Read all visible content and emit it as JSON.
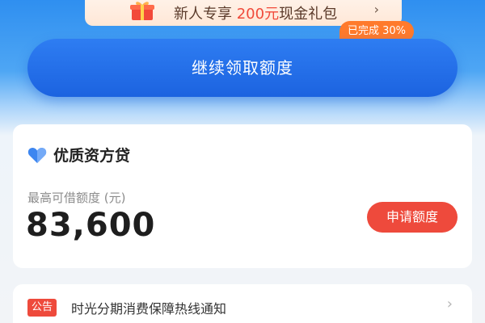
{
  "promo": {
    "text_prefix": "新人专享 ",
    "amount": "200元",
    "text_suffix": "现金礼包",
    "icon": "gift-icon",
    "chevron": "›"
  },
  "progress_badge": "已完成 30%",
  "cta_label": "继续领取额度",
  "loan_card": {
    "icon": "heart-icon",
    "title": "优质资方贷",
    "limit_label": "最高可借额度 (元)",
    "limit_amount": "83,600",
    "apply_label": "申请额度"
  },
  "notice": {
    "tag": "公告",
    "message": "时光分期消费保障热线通知",
    "chevron": "›"
  },
  "colors": {
    "primary_blue": "#1c63e0",
    "accent_red": "#ee4a3c",
    "badge_orange": "#ff7a2c"
  }
}
